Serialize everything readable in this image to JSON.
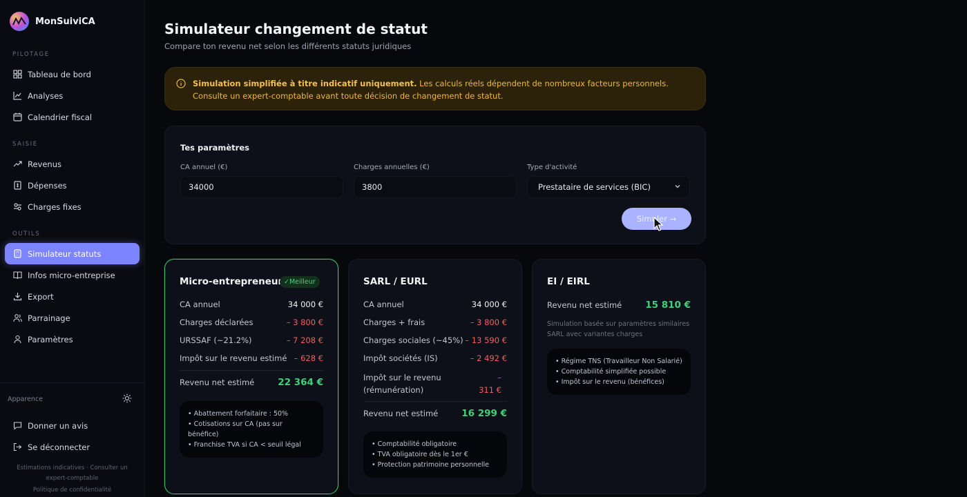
{
  "brand": {
    "name": "MonSuiviCA"
  },
  "sidebar": {
    "sections": [
      {
        "title": "PILOTAGE",
        "items": [
          {
            "label": "Tableau de bord",
            "icon": "dashboard-icon"
          },
          {
            "label": "Analyses",
            "icon": "chart-icon"
          },
          {
            "label": "Calendrier fiscal",
            "icon": "calendar-icon"
          }
        ]
      },
      {
        "title": "SAISIE",
        "items": [
          {
            "label": "Revenus",
            "icon": "trending-up-icon"
          },
          {
            "label": "Dépenses",
            "icon": "receipt-icon"
          },
          {
            "label": "Charges fixes",
            "icon": "sliders-icon"
          }
        ]
      },
      {
        "title": "OUTILS",
        "items": [
          {
            "label": "Simulateur statuts",
            "icon": "calculator-icon",
            "active": true
          },
          {
            "label": "Infos micro-entreprise",
            "icon": "book-icon"
          },
          {
            "label": "Export",
            "icon": "download-icon"
          },
          {
            "label": "Parrainage",
            "icon": "users-icon"
          },
          {
            "label": "Paramètres",
            "icon": "user-icon"
          }
        ]
      }
    ],
    "appearance_label": "Apparence",
    "feedback_label": "Donner un avis",
    "logout_label": "Se déconnecter",
    "footer_note": "Estimations indicatives · Consulter un expert-comptable",
    "privacy_label": "Politique de confidentialité"
  },
  "page": {
    "title": "Simulateur changement de statut",
    "subtitle": "Compare ton revenu net selon les différents statuts juridiques"
  },
  "warning": {
    "bold": "Simulation simplifiée à titre indicatif uniquement.",
    "text": " Les calculs réels dépendent de nombreux facteurs personnels. Consulte un expert-comptable avant toute décision de changement de statut."
  },
  "params": {
    "title": "Tes paramètres",
    "ca_label": "CA annuel (€)",
    "ca_value": "34000",
    "charges_label": "Charges annuelles (€)",
    "charges_value": "3800",
    "type_label": "Type d'activité",
    "type_value": "Prestataire de services (BIC)",
    "simulate_label": "Simuler →"
  },
  "cards": {
    "micro": {
      "title": "Micro-entrepreneur",
      "badge": "✓Meilleur",
      "rows": [
        {
          "label": "CA annuel",
          "value": "34 000 €"
        },
        {
          "label": "Charges déclarées",
          "value": "– 3 800 €"
        },
        {
          "label": "URSSAF (~21.2%)",
          "value": "– 7 208 €"
        },
        {
          "label": "Impôt sur le revenu estimé",
          "value": "– 628 €"
        }
      ],
      "net_label": "Revenu net estimé",
      "net_value": "22 364 €",
      "notes": [
        "• Abattement forfaitaire : 50%",
        "• Cotisations sur CA (pas sur bénéfice)",
        "• Franchise TVA si CA < seuil légal"
      ]
    },
    "sarl": {
      "title": "SARL / EURL",
      "rows": [
        {
          "label": "CA annuel",
          "value": "34 000 €"
        },
        {
          "label": "Charges + frais",
          "value": "– 3 800 €"
        },
        {
          "label": "Charges sociales (~45%)",
          "value": "– 13 590 €"
        },
        {
          "label": "Impôt sociétés (IS)",
          "value": "– 2 492 €"
        }
      ],
      "ir_label_1": "Impôt sur le revenu",
      "ir_label_2": "(rémunération)",
      "ir_value_1": "–",
      "ir_value_2": "311 €",
      "net_label": "Revenu net estimé",
      "net_value": "16 299 €",
      "notes": [
        "• Comptabilité obligatoire",
        "• TVA obligatoire dès le 1er €",
        "• Protection patrimoine personnelle"
      ]
    },
    "ei": {
      "title": "EI / EIRL",
      "net_label": "Revenu net estimé",
      "net_value": "15 810 €",
      "description": "Simulation basée sur paramètres similaires SARL avec variantes charges",
      "notes": [
        "• Régime TNS (Travailleur Non Salarié)",
        "• Comptabilité simplifiée possible",
        "• Impôt sur le revenu (bénéfices)"
      ]
    }
  },
  "colors": {
    "accent": "#7c85ff",
    "positive": "#3fd17a",
    "negative": "#f0605f",
    "warning": "#f0b73b"
  }
}
